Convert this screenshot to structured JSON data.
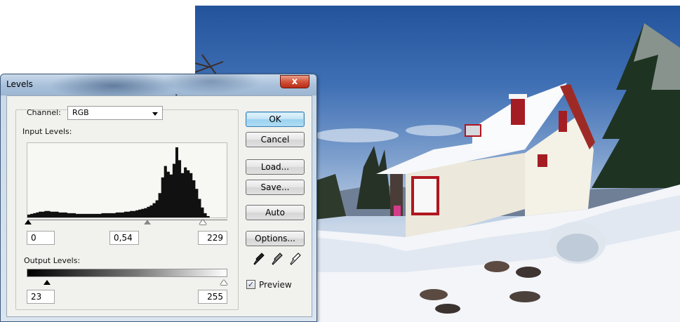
{
  "dialog": {
    "title": "Levels",
    "close_glyph": "x",
    "channel_label": "Channel:",
    "channel_value": "RGB",
    "input_levels_label": "Input Levels:",
    "output_levels_label": "Output Levels:",
    "input": {
      "shadow": "0",
      "midtone": "0,54",
      "highlight": "229"
    },
    "output": {
      "shadow": "23",
      "highlight": "255"
    },
    "buttons": {
      "ok": "OK",
      "cancel": "Cancel",
      "load": "Load...",
      "save": "Save...",
      "auto": "Auto",
      "options": "Options..."
    },
    "preview_label": "Preview",
    "preview_checked": true,
    "eyedroppers": [
      "black-point-eyedropper-icon",
      "gray-point-eyedropper-icon",
      "white-point-eyedropper-icon"
    ],
    "histogram": [
      4,
      5,
      6,
      7,
      8,
      8,
      9,
      9,
      8,
      8,
      8,
      7,
      7,
      7,
      6,
      6,
      6,
      5,
      5,
      5,
      5,
      5,
      5,
      5,
      5,
      5,
      6,
      6,
      6,
      6,
      6,
      7,
      7,
      7,
      8,
      8,
      9,
      9,
      10,
      11,
      12,
      13,
      15,
      17,
      20,
      24,
      34,
      56,
      72,
      64,
      60,
      75,
      98,
      80,
      62,
      70,
      66,
      62,
      52,
      40,
      26,
      14,
      6,
      2,
      0,
      0,
      0,
      0,
      0,
      0
    ]
  },
  "colors": {
    "sky": "#3f6fb4",
    "dialog_bg": "#f1f1ee",
    "ok_button": "#98d1ef",
    "close_button": "#d2533a",
    "house_trim": "#b01620"
  }
}
